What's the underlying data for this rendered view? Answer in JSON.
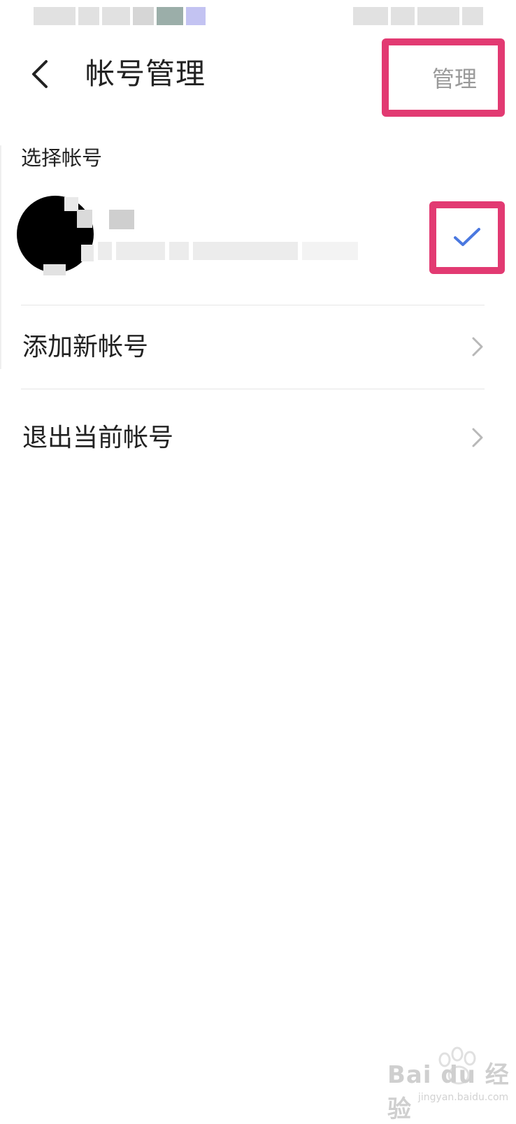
{
  "header": {
    "title": "帐号管理",
    "manage_label": "管理"
  },
  "account_section": {
    "label": "选择帐号",
    "selected": true
  },
  "menu": {
    "items": [
      {
        "label": "添加新帐号"
      },
      {
        "label": "退出当前帐号"
      }
    ]
  },
  "watermark": {
    "text": "Bai du 经验",
    "url": "jingyan.baidu.com"
  },
  "colors": {
    "highlight_border": "#e23a72",
    "check_blue": "#4a78e0",
    "manage_text": "#9a9a9a",
    "divider": "#e6e6e6"
  },
  "icons": {
    "back": "chevron-left-icon",
    "check": "check-icon",
    "row_arrow": "chevron-right-icon"
  }
}
